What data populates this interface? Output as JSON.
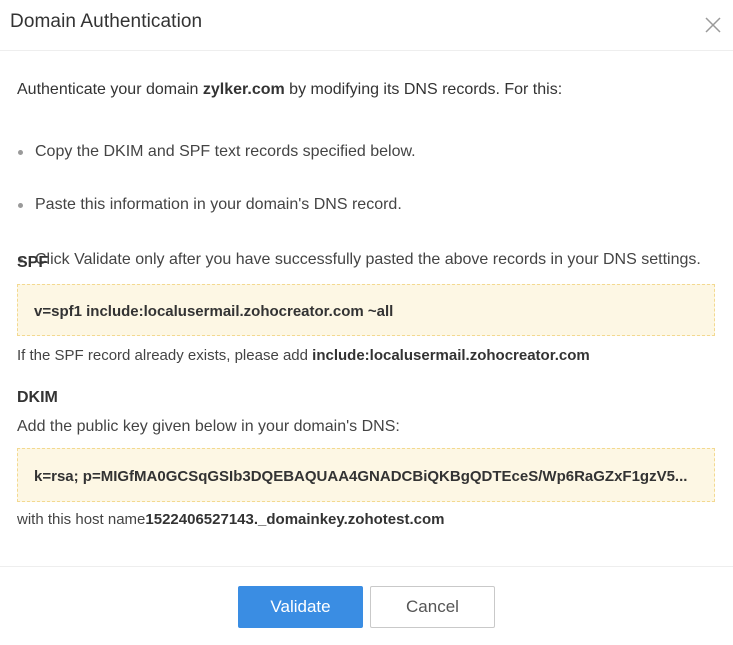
{
  "dialog": {
    "title": "Domain Authentication",
    "intro_prefix": "Authenticate your domain ",
    "domain": "zylker.com",
    "intro_suffix": " by modifying its DNS records. For this:",
    "bullets": [
      "Copy the DKIM and SPF text records specified below.",
      "Paste this information in your domain's DNS record.",
      "Click Validate only after you have successfully pasted the above records in your DNS settings."
    ],
    "spf": {
      "heading": "SPF",
      "record": "v=spf1 include:localusermail.zohocreator.com ~all",
      "note_prefix": "If the SPF record already exists, please add ",
      "note_value": "include:localusermail.zohocreator.com"
    },
    "dkim": {
      "heading": "DKIM",
      "instruction": "Add the public key given below in your domain's DNS:",
      "record": "k=rsa; p=MIGfMA0GCSqGSIb3DQEBAQUAA4GNADCBiQKBgQDTEceS/Wp6RaGZxF1gzV5...",
      "host_prefix": "with this host name",
      "host_value": "1522406527143._domainkey.zohotest.com"
    },
    "buttons": {
      "validate": "Validate",
      "cancel": "Cancel"
    },
    "icons": {
      "close": "close-icon"
    },
    "colors": {
      "primary": "#3a8de3",
      "record_bg": "#fdf7e4",
      "record_border": "#f3d990"
    }
  }
}
